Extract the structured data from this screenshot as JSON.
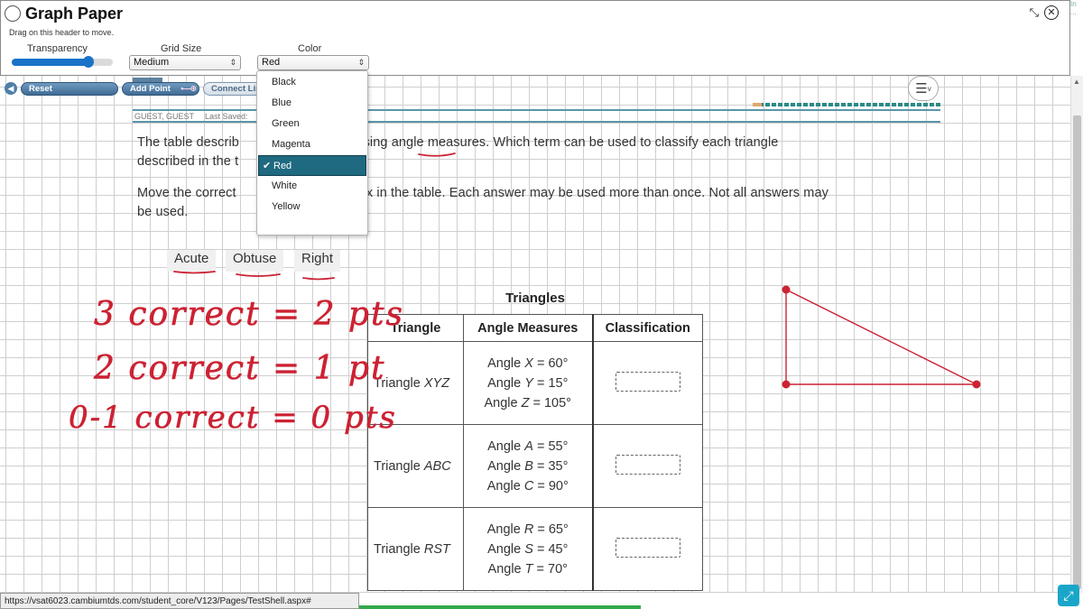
{
  "window": {
    "title": "Graph Paper",
    "drag_hint": "Drag on this header to move.",
    "controls": {
      "collapse_glyph": "⤡",
      "close_glyph": "✕"
    }
  },
  "controls": {
    "transparency_label": "Transparency",
    "transparency_value": 0.76,
    "grid_size_label": "Grid Size",
    "grid_size_value": "Medium",
    "color_label": "Color",
    "color_value": "Red",
    "color_options": [
      "Black",
      "Blue",
      "Green",
      "Magenta",
      "Red",
      "White",
      "Yellow"
    ],
    "selected_color_index": 4,
    "accent_color": "#1f6a80",
    "slider_color": "#1a73c8"
  },
  "toolbar": {
    "reset_label": "Reset",
    "add_point_label": "Add Point",
    "connect_line_label": "Connect Line"
  },
  "student_bar": {
    "user": "GUEST, GUEST",
    "saved": "Last Saved:"
  },
  "question": {
    "line1": "The table describ",
    "line1_tail": "s using angle measures. Which term can be used to classify each triangle",
    "line1b": "described in the t",
    "line2": "Move the correct",
    "line2_tail": "box in the table. Each answer may be used more than once. Not all answers may",
    "line2b": "be used."
  },
  "answers": [
    "Acute",
    "Obtuse",
    "Right"
  ],
  "table": {
    "caption": "Triangles",
    "headers": [
      "Triangle",
      "Angle Measures",
      "Classification"
    ],
    "rows": [
      {
        "name_prefix": "Triangle ",
        "name_var": "XYZ",
        "angles": [
          {
            "pre": "Angle ",
            "var": "X",
            "post": " = 60°"
          },
          {
            "pre": "Angle ",
            "var": "Y",
            "post": " = 15°"
          },
          {
            "pre": "Angle ",
            "var": "Z",
            "post": " = 105°"
          }
        ]
      },
      {
        "name_prefix": "Triangle ",
        "name_var": "ABC",
        "angles": [
          {
            "pre": "Angle ",
            "var": "A",
            "post": " = 55°"
          },
          {
            "pre": "Angle ",
            "var": "B",
            "post": " = 35°"
          },
          {
            "pre": "Angle ",
            "var": "C",
            "post": " = 90°"
          }
        ]
      },
      {
        "name_prefix": "Triangle ",
        "name_var": "RST",
        "angles": [
          {
            "pre": "Angle ",
            "var": "R",
            "post": " = 65°"
          },
          {
            "pre": "Angle ",
            "var": "S",
            "post": " = 45°"
          },
          {
            "pre": "Angle ",
            "var": "T",
            "post": " = 70°"
          }
        ]
      }
    ]
  },
  "annotations": {
    "ink_color": "#cc2233",
    "scoring": [
      "3 correct = 2 pts",
      "2 correct = 1 pt",
      "0-1 correct = 0 pts"
    ]
  },
  "drawn_triangle": {
    "color": "#cc2233"
  },
  "status_url": "https://vsat6023.cambiumtds.com/student_core/V123/Pages/TestShell.aspx#",
  "side_strip": [
    "In",
    "..."
  ]
}
